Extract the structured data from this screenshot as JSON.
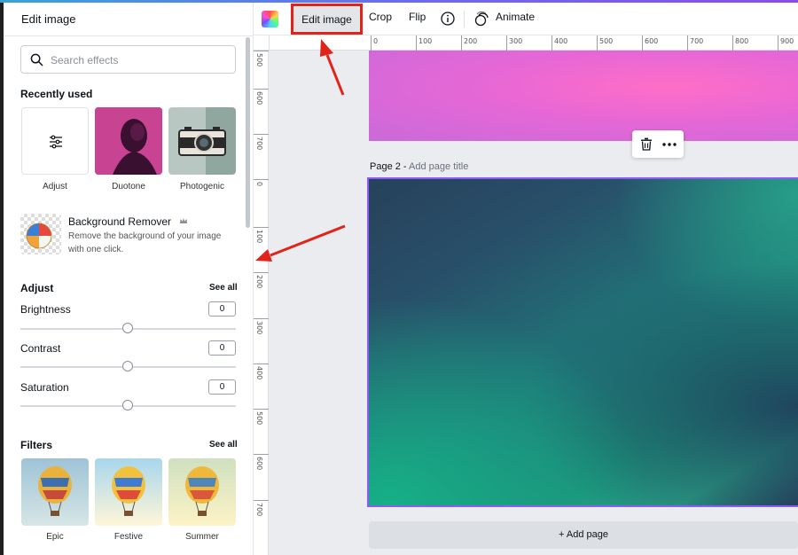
{
  "panel": {
    "title": "Edit image",
    "search_placeholder": "Search effects",
    "recently_used_title": "Recently used",
    "recent": [
      {
        "label": "Adjust",
        "icon": "sliders-icon"
      },
      {
        "label": "Duotone"
      },
      {
        "label": "Photogenic"
      }
    ],
    "bg_remover": {
      "title": "Background Remover",
      "description": "Remove the background of your image with one click.",
      "badge_icon": "crown-icon"
    },
    "adjust": {
      "title": "Adjust",
      "see_all": "See all",
      "sliders": [
        {
          "label": "Brightness",
          "value": "0",
          "level": 0.5
        },
        {
          "label": "Contrast",
          "value": "0",
          "level": 0.5
        },
        {
          "label": "Saturation",
          "value": "0",
          "level": 0.5
        }
      ]
    },
    "filters": {
      "title": "Filters",
      "see_all": "See all",
      "items": [
        {
          "label": "Epic"
        },
        {
          "label": "Festive"
        },
        {
          "label": "Summer"
        }
      ]
    }
  },
  "toolbar": {
    "edit_image": "Edit image",
    "crop": "Crop",
    "flip": "Flip",
    "animate": "Animate"
  },
  "ruler": {
    "top_ticks": [
      "0",
      "100",
      "200",
      "300",
      "400",
      "500",
      "600",
      "700",
      "800",
      "900"
    ],
    "left_ticks": [
      "500",
      "600",
      "700",
      "0",
      "100",
      "200",
      "300",
      "400",
      "500",
      "600",
      "700"
    ]
  },
  "canvas": {
    "page2_title": "Page 2 -",
    "page2_subtitle": "Add page title",
    "add_page": "+ Add page"
  },
  "colors": {
    "annotation_red": "#e2231a",
    "selection_purple": "#8b5cf6"
  }
}
